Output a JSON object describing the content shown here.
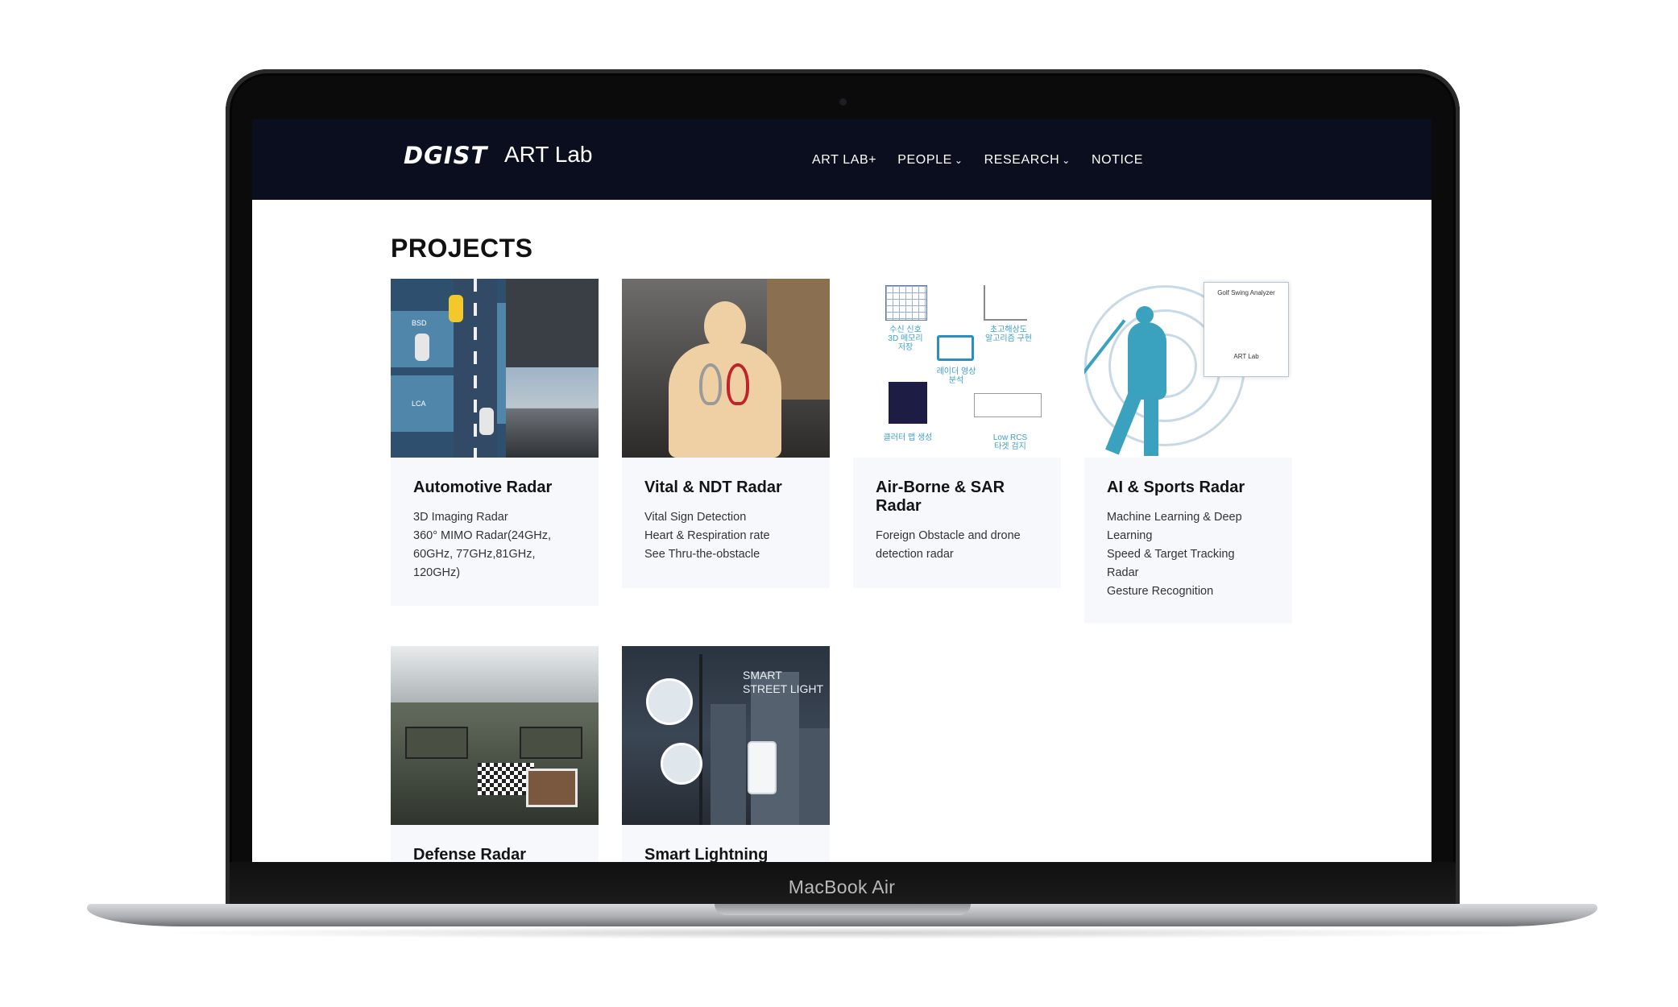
{
  "device": {
    "label": "MacBook Air"
  },
  "header": {
    "logo_text": "DGIST",
    "lab_name": "ART Lab",
    "nav": [
      {
        "label": "ART LAB+",
        "dropdown": false
      },
      {
        "label": "PEOPLE",
        "dropdown": true
      },
      {
        "label": "RESEARCH",
        "dropdown": true
      },
      {
        "label": "NOTICE",
        "dropdown": false
      }
    ]
  },
  "page": {
    "title": "PROJECTS"
  },
  "projects": [
    {
      "title": "Automotive Radar",
      "lines": [
        "3D Imaging Radar",
        "360° MIMO Radar(24GHz,",
        "60GHz, 77GHz,81GHz,",
        "120GHz)"
      ],
      "image_text": [
        "BSD",
        "LCA"
      ]
    },
    {
      "title": "Vital & NDT Radar",
      "lines": [
        "Vital Sign Detection",
        "Heart & Respiration rate",
        "See Thru-the-obstacle"
      ]
    },
    {
      "title": "Air-Borne & SAR Radar",
      "lines": [
        "Foreign Obstacle and drone",
        "detection radar"
      ],
      "image_text": [
        "수신 신호",
        "3D 메모리",
        "저장",
        "초고해상도",
        "알고리즘 구현",
        "레이더 영상",
        "분석",
        "클러터 맵 생성",
        "Low RCS",
        "타겟 검지"
      ]
    },
    {
      "title": "AI & Sports Radar",
      "lines": [
        "Machine Learning & Deep",
        "Learning",
        "Speed & Target Tracking",
        "Radar",
        "Gesture Recognition"
      ],
      "image_text": [
        "Golf Swing Analyzer",
        "ART Lab"
      ]
    },
    {
      "title": "Defense Radar",
      "lines": []
    },
    {
      "title": "Smart Lightning",
      "lines": [],
      "image_text": [
        "SMART",
        "STREET LIGHT"
      ]
    }
  ],
  "colors": {
    "navbar": "#0a0e1e",
    "card_bg": "#f6f8fb",
    "accent_cyan": "#3aa1bf"
  }
}
